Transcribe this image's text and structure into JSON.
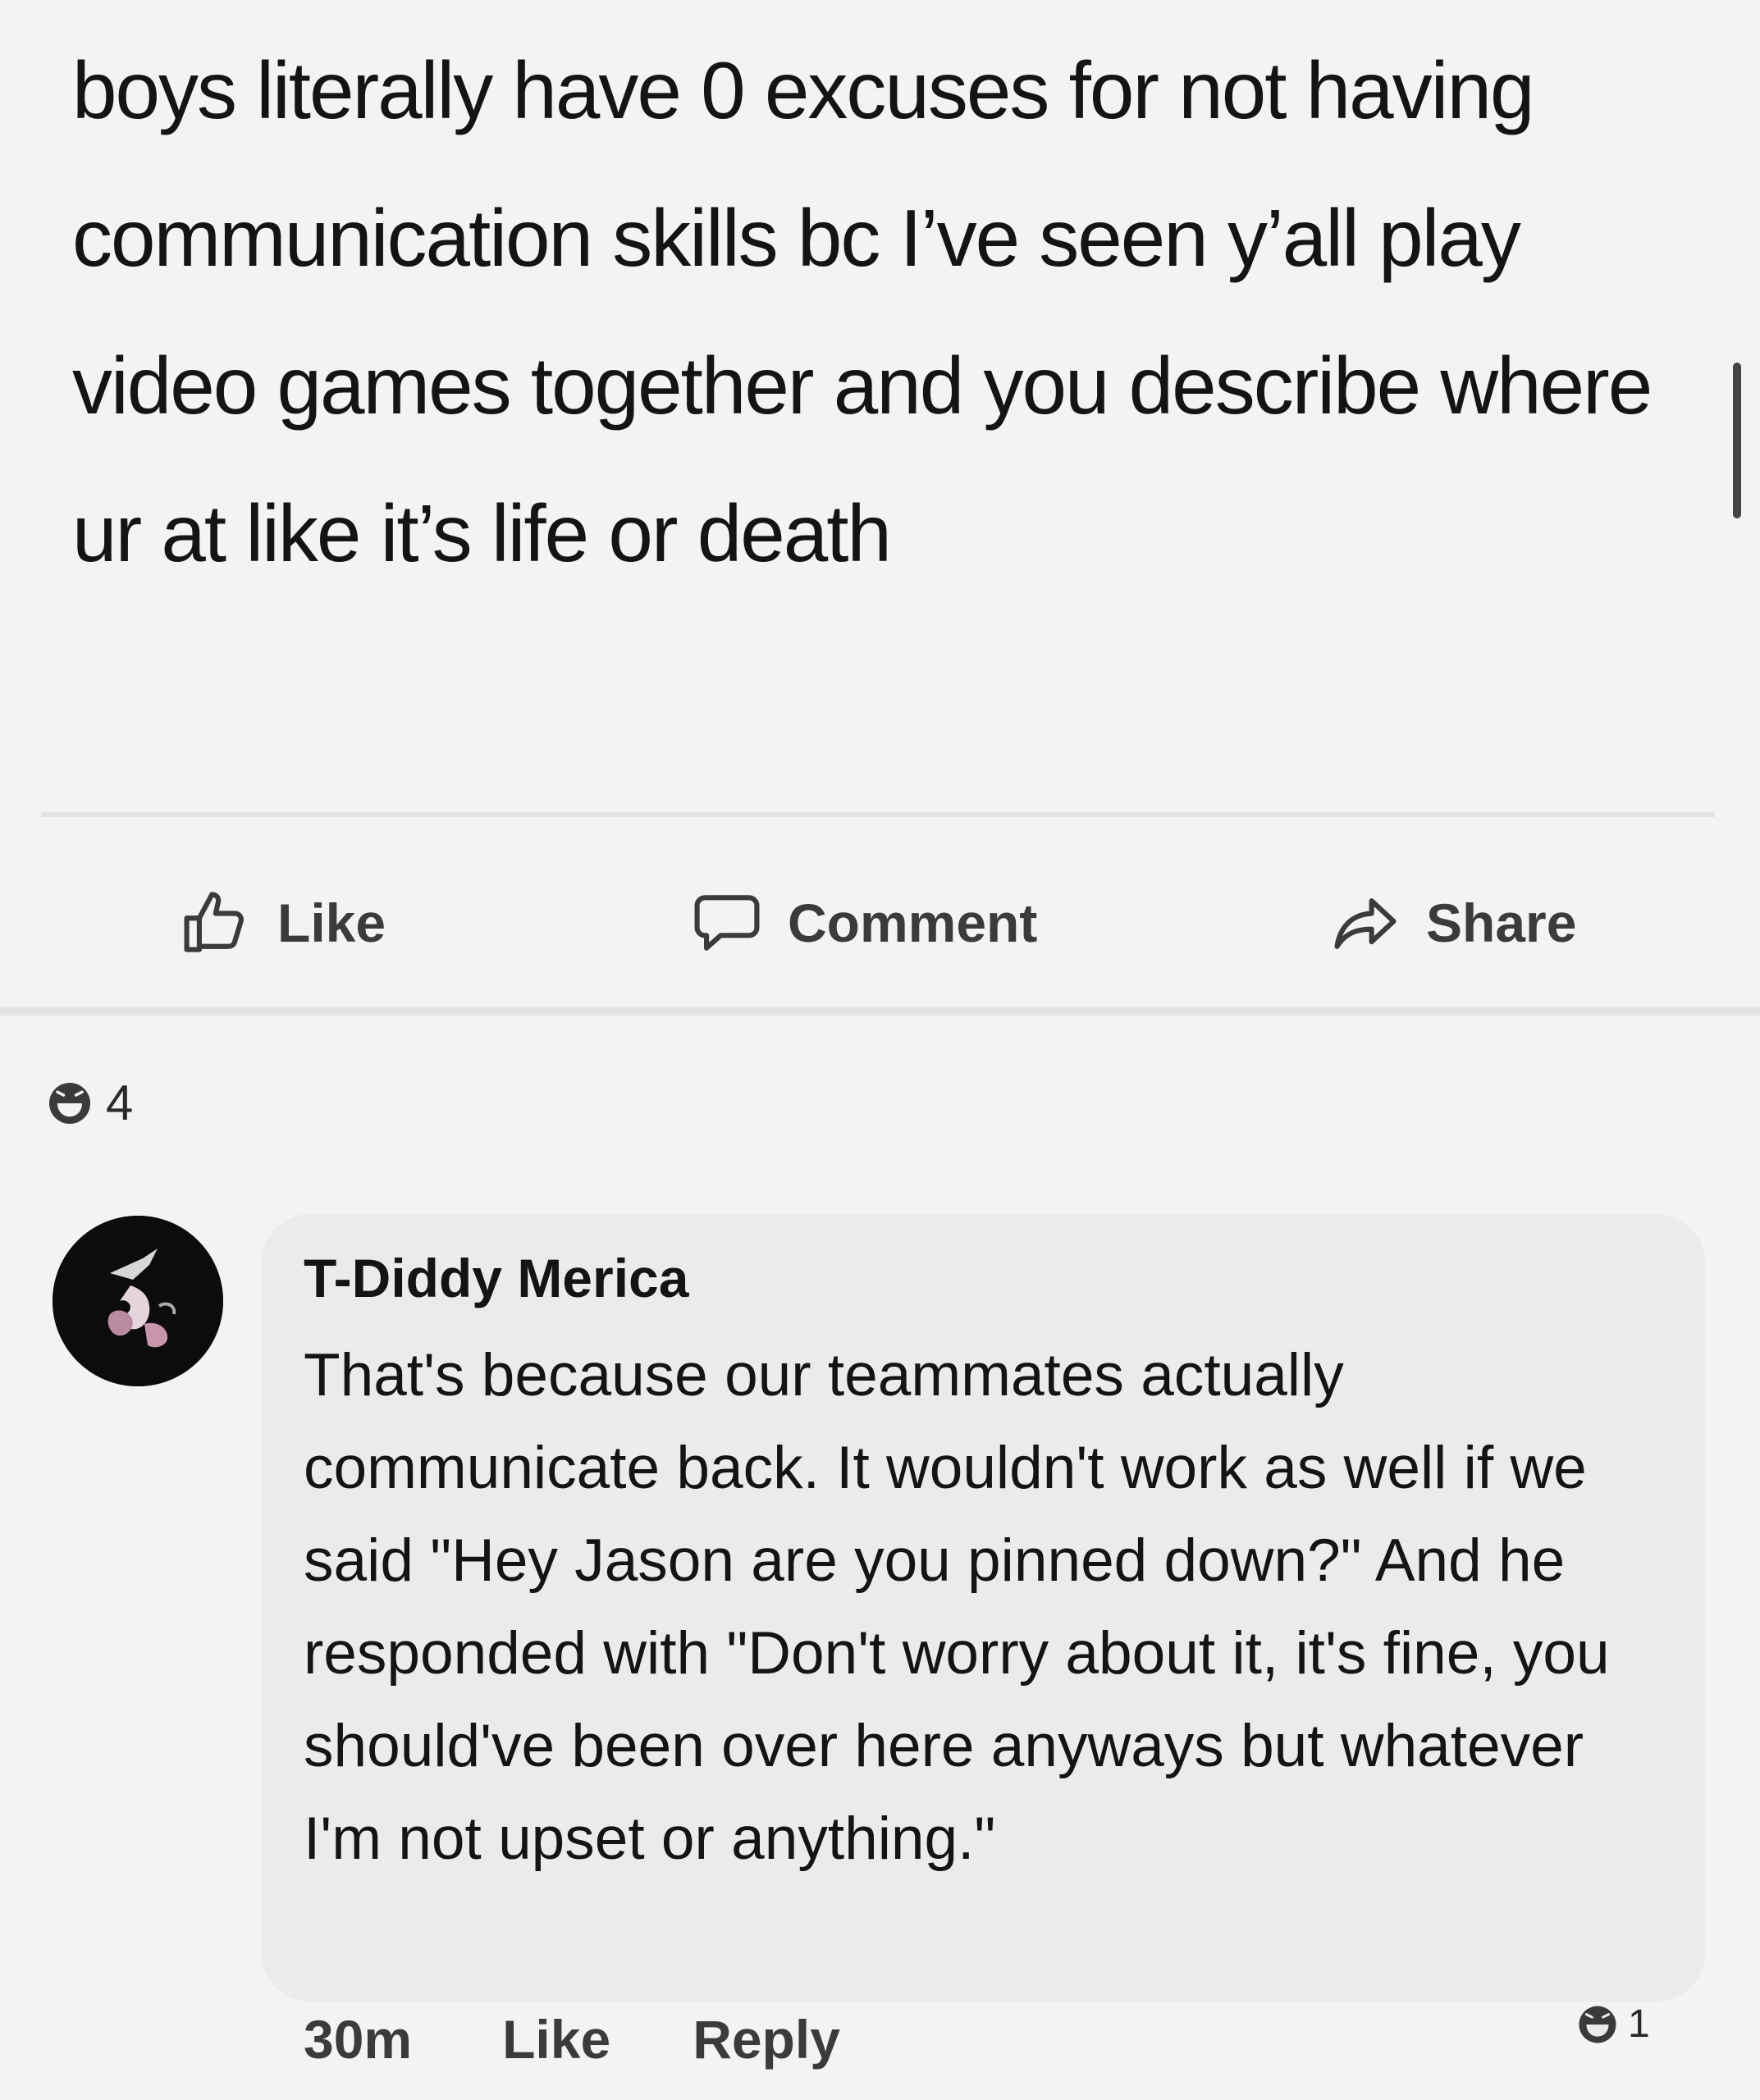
{
  "post": {
    "text": "boys literally have 0 excuses for not having communication skills bc I’ve seen y’all play video games together and you describe where ur at like it’s life or death"
  },
  "actions": {
    "like": "Like",
    "comment": "Comment",
    "share": "Share"
  },
  "reactions": {
    "icon": "haha-emoji-icon",
    "count": "4"
  },
  "comment": {
    "author": "T-Diddy Merica",
    "text": "That's because our teammates actually communicate back. It wouldn't work as well if we said \"Hey Jason are you pinned down?\" And he responded with \"Don't worry about it, it's fine, you should've been over here anyways but whatever I'm not upset or anything.\"",
    "reaction_count": "1",
    "time": "30m",
    "like_label": "Like",
    "reply_label": "Reply"
  },
  "colors": {
    "background": "#f3f3f5",
    "bubble": "#ebebee",
    "text": "#141414",
    "action_text": "#3a3b3c"
  }
}
